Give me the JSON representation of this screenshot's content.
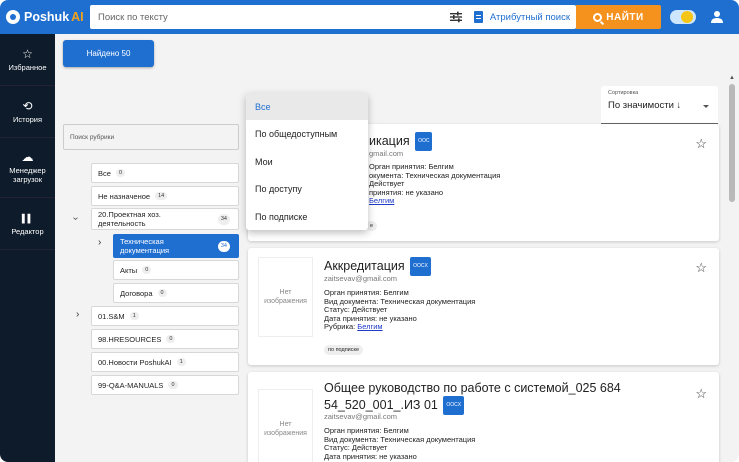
{
  "brand": {
    "name_part1": "Poshuk",
    "name_part2": "AI"
  },
  "header": {
    "search_placeholder": "Поиск по тексту",
    "attr_search_label": "Атрибутный поиск",
    "find_button_label": "НАЙТИ"
  },
  "sidebar": {
    "items": [
      {
        "label": "Избранное",
        "icon": "star-icon",
        "glyph": "☆"
      },
      {
        "label": "История",
        "icon": "history-icon",
        "glyph": "⟲"
      },
      {
        "label": "Менеджер загрузок",
        "icon": "cloud-upload-icon",
        "glyph": "☁"
      },
      {
        "label": "Редактор",
        "icon": "editor-icon",
        "glyph": "▌▌"
      }
    ]
  },
  "found_button_label": "Найдено 50",
  "rubric_search_placeholder": "Поиск рубрики",
  "tree": [
    {
      "label": "Все",
      "count": "0"
    },
    {
      "label": "Не назначеное",
      "count": "14"
    },
    {
      "label": "20.Проектная хоз. деятельность",
      "count": "34"
    },
    {
      "label": "Техническая документация",
      "count": "34"
    },
    {
      "label": "Акты",
      "count": "0"
    },
    {
      "label": "Договора",
      "count": "0"
    },
    {
      "label": "01.S&M",
      "count": "1"
    },
    {
      "label": "98.HRESOURCES",
      "count": "0"
    },
    {
      "label": "00.Новости PoshukAI",
      "count": "1"
    },
    {
      "label": "99-Q&A-MANUALS",
      "count": "0"
    }
  ],
  "sort": {
    "label": "Сортировка",
    "value": "По значимости ↓"
  },
  "dropdown": {
    "options": [
      "Все",
      "По общедоступным",
      "Мои",
      "По доступу",
      "По подписке"
    ],
    "selected": "Все"
  },
  "cards": [
    {
      "title_visible": "икация",
      "badge": "OOC",
      "email_visible": "gmail.com",
      "lines": [
        "Орган принятия: Белгим",
        "окумента: Техническая документация",
        "Действует",
        "принятия: не указано"
      ],
      "link_visible": "Белгим",
      "tag_visible": "е"
    },
    {
      "thumb": "Нет изображения",
      "title": "Аккредитация",
      "badge": "OOCX",
      "email": "zaitsevav@gmail.com",
      "lines": [
        "Орган принятия: Белгим",
        "Вид документа: Техническая документация",
        "Статус: Действует",
        "Дата принятия: не указано"
      ],
      "rubric_label": "Рубрика: ",
      "rubric_link": "Белгим",
      "tag": "по подписке"
    },
    {
      "thumb": "Нет изображения",
      "title": "Общее руководство по работе с системой_025 684 54_520_001_.ИЗ 01",
      "badge": "OOCX",
      "email": "zaitsevav@gmail.com",
      "lines": [
        "Орган принятия: Белгим",
        "Вид документа: Техническая документация",
        "Статус: Действует",
        "Дата принятия: не указано"
      ]
    }
  ],
  "colors": {
    "primary": "#1f6fd1",
    "accent": "#f5921e",
    "sidebar": "#0d1b2a"
  }
}
